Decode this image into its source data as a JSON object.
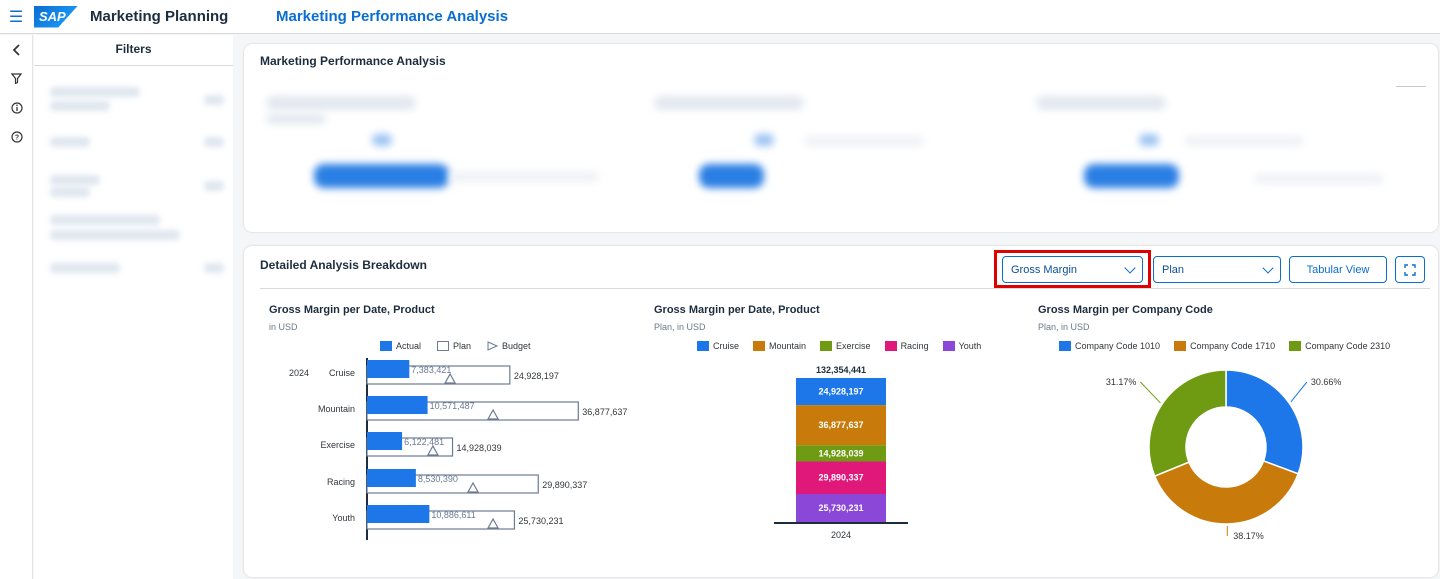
{
  "shell": {
    "menu_icon": "hamburger-icon",
    "logo": "SAP",
    "app_title": "Marketing Planning",
    "page_title": "Marketing Performance Analysis"
  },
  "rail": {
    "icons": [
      "back-icon",
      "filter-icon",
      "info-icon",
      "help-icon"
    ]
  },
  "filters": {
    "title": "Filters"
  },
  "overview": {
    "title": "Marketing Performance Analysis"
  },
  "breakdown": {
    "title": "Detailed Analysis Breakdown",
    "measure_select": "Gross Margin",
    "version_select": "Plan",
    "tabular_button": "Tabular View",
    "fullscreen_icon": "fullscreen-icon"
  },
  "colors": {
    "accent": "#0a6ed1",
    "highlight": "#e00000"
  },
  "chart_data": [
    {
      "type": "bar",
      "title": "Gross Margin per Date, Product",
      "subtitle": "in USD",
      "legend": [
        "Actual",
        "Plan",
        "Budget"
      ],
      "group": "2024",
      "categories": [
        "Cruise",
        "Mountain",
        "Exercise",
        "Racing",
        "Youth"
      ],
      "series": [
        {
          "name": "Actual",
          "values": [
            7383421,
            10571487,
            6122481,
            8530390,
            10886611
          ],
          "labels": [
            "7,383,421",
            "10,571,487",
            "6,122,481",
            "8,530,390",
            "10,886,611"
          ]
        },
        {
          "name": "Plan",
          "values": [
            24928197,
            36877637,
            14928039,
            29890337,
            25730231
          ],
          "labels": [
            "24,928,197",
            "36,877,637",
            "14,928,039",
            "29,890,337",
            "25,730,231"
          ]
        },
        {
          "name": "Budget",
          "values": [
            14500000,
            22000000,
            11500000,
            18500000,
            22000000
          ]
        }
      ],
      "colors": {
        "actual": "#1e77e8",
        "plan_border": "#6c7b93",
        "budget_border": "#6c7b93"
      }
    },
    {
      "type": "bar",
      "stacked": true,
      "title": "Gross Margin per Date, Product",
      "subtitle": "Plan, in USD",
      "categories": [
        "2024"
      ],
      "total_label": "132,354,441",
      "series": [
        {
          "name": "Cruise",
          "value": 24928197,
          "label": "24,928,197",
          "color": "#1e77e8"
        },
        {
          "name": "Mountain",
          "value": 36877637,
          "label": "36,877,637",
          "color": "#c87b0b"
        },
        {
          "name": "Exercise",
          "value": 14928039,
          "label": "14,928,039",
          "color": "#6e9b11"
        },
        {
          "name": "Racing",
          "value": 29890337,
          "label": "29,890,337",
          "color": "#e0187a"
        },
        {
          "name": "Youth",
          "value": 25730231,
          "label": "25,730,231",
          "color": "#8b47d7"
        }
      ]
    },
    {
      "type": "pie",
      "donut": true,
      "title": "Gross Margin per Company Code",
      "subtitle": "Plan, in USD",
      "slices": [
        {
          "name": "Company Code 1010",
          "value": 30.66,
          "label": "30.66%",
          "color": "#1e77e8"
        },
        {
          "name": "Company Code 1710",
          "value": 38.17,
          "label": "38.17%",
          "color": "#c87b0b"
        },
        {
          "name": "Company Code 2310",
          "value": 31.17,
          "label": "31.17%",
          "color": "#6e9b11"
        }
      ]
    }
  ]
}
